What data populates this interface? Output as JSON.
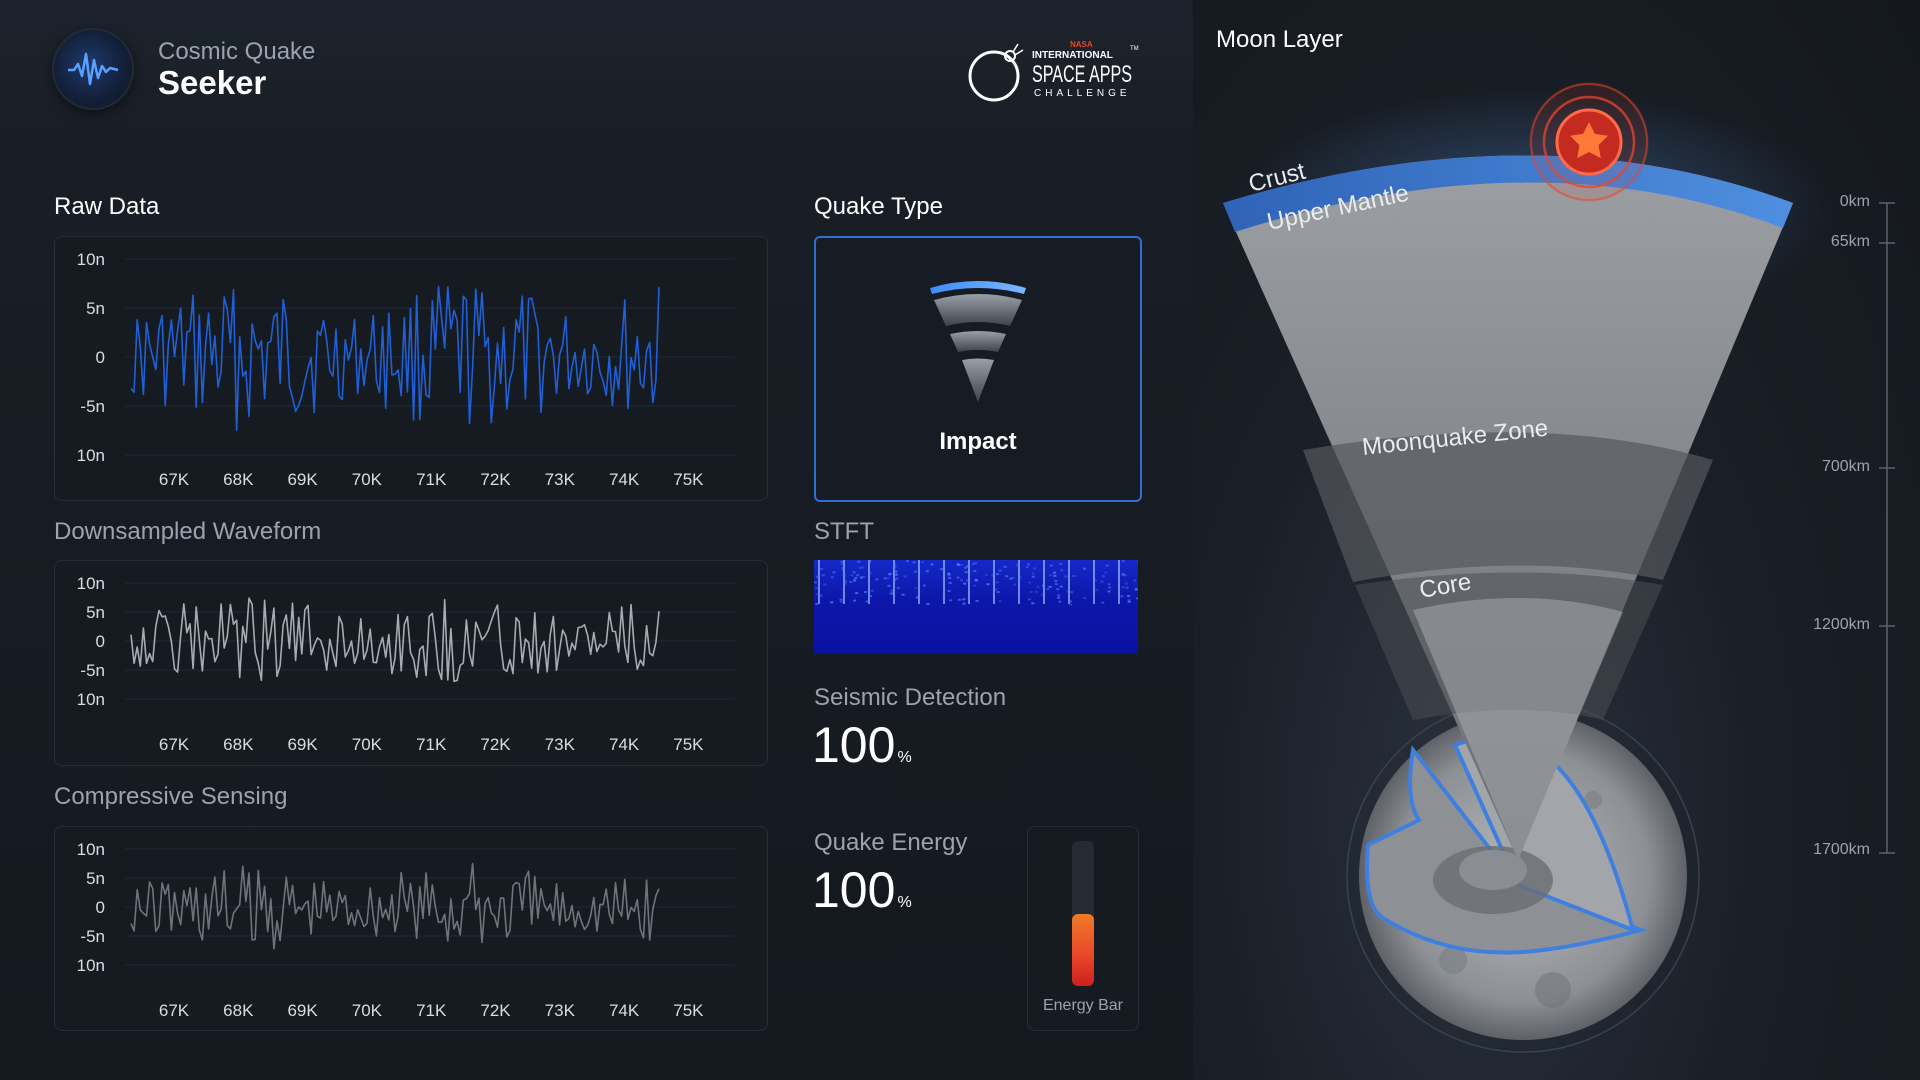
{
  "app": {
    "subtitle": "Cosmic Quake",
    "title": "Seeker"
  },
  "sponsor": {
    "line1": "NASA",
    "line2": "INTERNATIONAL",
    "line3": "SPACE APPS",
    "line4": "CHALLENGE",
    "tm": "TM"
  },
  "sections": {
    "raw": "Raw Data",
    "downsampled": "Downsampled Waveform",
    "compressive": "Compressive Sensing",
    "quake_type": "Quake Type",
    "stft": "STFT",
    "seismic": "Seismic Detection",
    "energy": "Quake Energy",
    "moon": "Moon Layer"
  },
  "quake": {
    "label": "Impact"
  },
  "metrics": {
    "seismic_value": "100",
    "seismic_unit": "%",
    "energy_value": "100",
    "energy_unit": "%",
    "energy_bar_label": "Energy Bar",
    "energy_level": 0.5
  },
  "chart_axes": {
    "y_labels_raw": [
      "10n",
      "5n",
      "0",
      "-5n",
      "10n"
    ],
    "y_labels": [
      "10n",
      "5n",
      "0",
      "-5n",
      "10n"
    ],
    "x_labels": [
      "67K",
      "68K",
      "69K",
      "70K",
      "71K",
      "72K",
      "73K",
      "74K",
      "75K"
    ]
  },
  "colors": {
    "raw": "#1f5fd8",
    "downsampled": "#a7abb2",
    "compressive": "#6f747b",
    "accent": "#2f6fd0",
    "marker": "#e8452a"
  },
  "moon": {
    "layers": [
      "Crust",
      "Upper Mantle",
      "Moonquake Zone",
      "Core"
    ],
    "depths": [
      "0km",
      "65km",
      "700km",
      "1200km",
      "1700km"
    ]
  }
}
